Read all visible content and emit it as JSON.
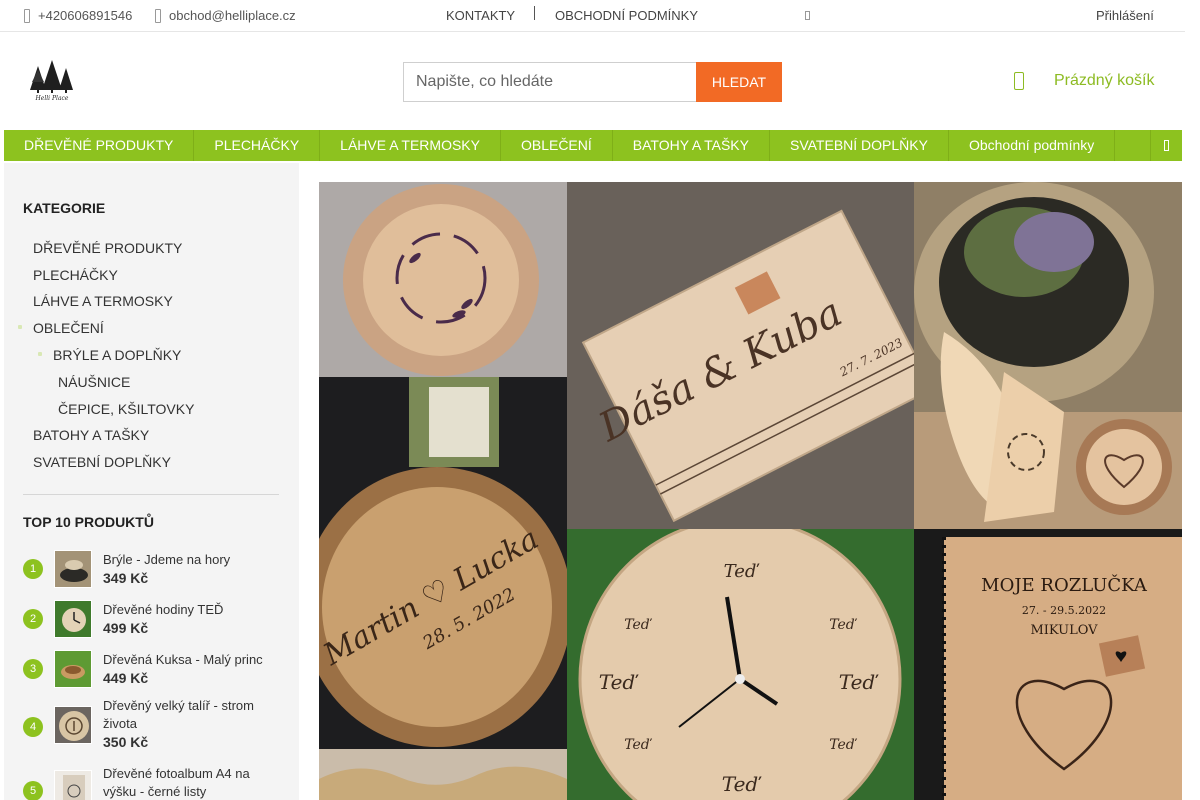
{
  "topbar": {
    "phone": "+420606891546",
    "email": "obchod@helliplace.cz",
    "links": [
      "KONTAKTY",
      "OBCHODNÍ PODMÍNKY"
    ],
    "login": "Přihlášení"
  },
  "header": {
    "logo_text": "Helli Place",
    "search": {
      "placeholder": "Napište, co hledáte",
      "button": "HLEDAT"
    },
    "cart_label": "Prázdný košík"
  },
  "nav": {
    "items": [
      "DŘEVĚNÉ PRODUKTY",
      "PLECHÁČKY",
      "LÁHVE A TERMOSKY",
      "OBLEČENÍ",
      "BATOHY A TAŠKY",
      "SVATEBNÍ DOPLŇKY",
      "Obchodní podmínky"
    ]
  },
  "sidebar": {
    "categories_title": "KATEGORIE",
    "categories": [
      {
        "label": "DŘEVĚNÉ PRODUKTY",
        "level": 0
      },
      {
        "label": "PLECHÁČKY",
        "level": 0
      },
      {
        "label": "LÁHVE A TERMOSKY",
        "level": 0
      },
      {
        "label": "OBLEČENÍ",
        "level": 0
      },
      {
        "label": "BRÝLE A DOPLŇKY",
        "level": 1
      },
      {
        "label": "NÁUŠNICE",
        "level": 2
      },
      {
        "label": "ČEPICE, KŠILTOVKY",
        "level": 2
      },
      {
        "label": "BATOHY A TAŠKY",
        "level": 0
      },
      {
        "label": "SVATEBNÍ DOPLŇKY",
        "level": 0
      }
    ],
    "top_title": "TOP 10 PRODUKTŮ",
    "top_products": [
      {
        "rank": "1",
        "name": "Brýle - Jdeme na hory",
        "price": "349 Kč"
      },
      {
        "rank": "2",
        "name": "Dřevěné hodiny TEĎ",
        "price": "499 Kč"
      },
      {
        "rank": "3",
        "name": "Dřevěná Kuksa - Malý princ",
        "price": "449 Kč"
      },
      {
        "rank": "4",
        "name": "Dřevěný velký talíř - strom života",
        "price": "350 Kč"
      },
      {
        "rank": "5",
        "name": "Dřevěné fotoalbum A4 na výšku - černé listy",
        "price": ""
      }
    ]
  },
  "banner": {
    "plate_names": "Martin ♡ Lucka",
    "plate_date": "28. 5. 2022",
    "book_names": "Dáša & Kuba",
    "book_date": "27. 7. 2023",
    "clock_word": "Teď",
    "album_title": "MOJE ROZLUČKA",
    "album_date": "27. - 29.5.2022",
    "album_place": "MIKULOV"
  }
}
